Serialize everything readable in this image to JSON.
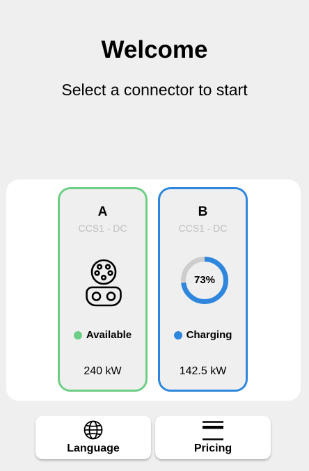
{
  "header": {
    "title": "Welcome",
    "subtitle": "Select a connector to start"
  },
  "connectors": [
    {
      "letter": "A",
      "type": "CCS1 - DC",
      "status": "Available",
      "status_color": "#6dce86",
      "power": "240 kW",
      "border_color": "#6dce86",
      "icon": "ccs1-connector-icon"
    },
    {
      "letter": "B",
      "type": "CCS1 - DC",
      "status": "Charging",
      "status_color": "#2f87dd",
      "power": "142.5 kW",
      "border_color": "#2f87dd",
      "progress": 0.73,
      "progress_label": "73%"
    }
  ],
  "actions": {
    "language": {
      "label": "Language",
      "icon": "globe-icon"
    },
    "pricing": {
      "label": "Pricing",
      "icon": "credit-card-icon"
    }
  }
}
